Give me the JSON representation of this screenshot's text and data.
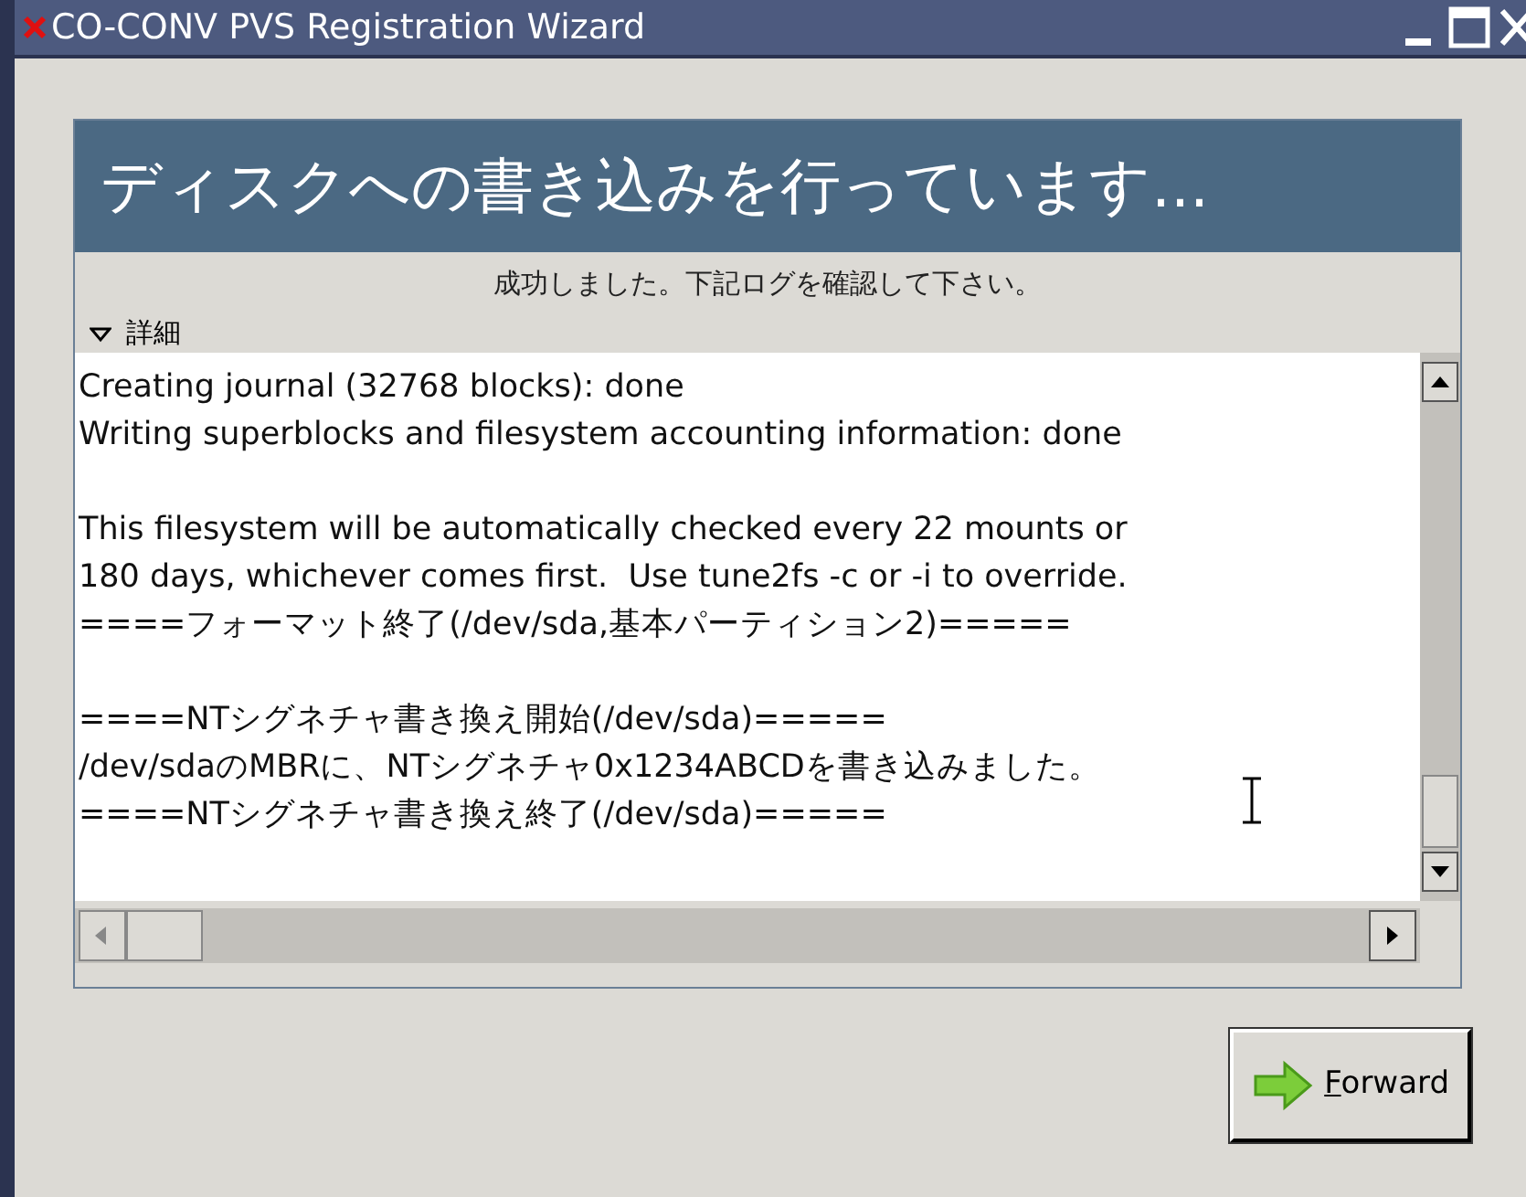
{
  "window": {
    "title": "CO-CONV PVS Registration Wizard"
  },
  "header": {
    "title": "ディスクへの書き込みを行っています..."
  },
  "status": "成功しました。下記ログを確認して下さい。",
  "details": {
    "label": "詳細",
    "expanded": true
  },
  "log": [
    [
      "Creating journal (32768 blocks): done",
      "Writing superblocks and filesystem accounting information: done"
    ],
    [
      "This filesystem will be automatically checked every 22 mounts or",
      "180 days, whichever comes first.  Use tune2fs -c or -i to override.",
      "====フォーマット終了(/dev/sda,基本パーティション2)====="
    ],
    [
      "====NTシグネチャ書き換え開始(/dev/sda)=====",
      "/dev/sdaのMBRに、NTシグネチャ0x1234ABCDを書き込みました。",
      "====NTシグネチャ書き換え終了(/dev/sda)====="
    ]
  ],
  "buttons": [
    {
      "label": "Forward"
    }
  ]
}
